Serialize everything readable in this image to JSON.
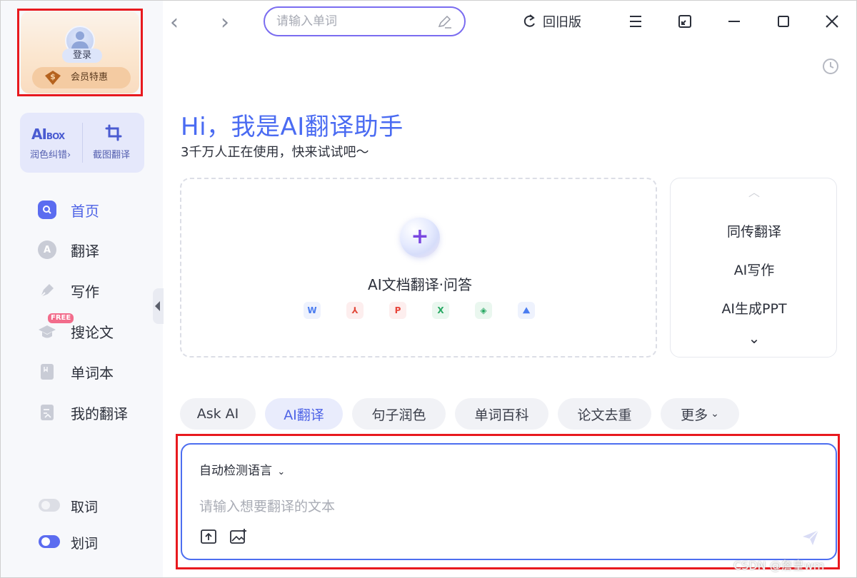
{
  "sidebar": {
    "login_label": "登录",
    "vip_label": "会员特惠",
    "toolbox": {
      "aibox_logo": "AI",
      "aibox_logo_small": "BOX",
      "polish_label": "润色纠错",
      "polish_chevron": "›",
      "screenshot_label": "截图翻译"
    },
    "nav": [
      {
        "label": "首页",
        "icon": "home-icon"
      },
      {
        "label": "翻译",
        "icon": "translate-icon"
      },
      {
        "label": "写作",
        "icon": "pen-icon"
      },
      {
        "label": "搜论文",
        "icon": "graduation-cap-icon",
        "badge": "FREE"
      },
      {
        "label": "单词本",
        "icon": "notebook-icon"
      },
      {
        "label": "我的翻译",
        "icon": "document-icon"
      }
    ],
    "toggles": [
      {
        "label": "取词",
        "on": false
      },
      {
        "label": "划词",
        "on": true
      }
    ]
  },
  "topbar": {
    "back": "‹",
    "forward": "›",
    "search_placeholder": "请输入单词",
    "old_version_label": "回旧版"
  },
  "hero": {
    "title": "Hi，我是AI翻译助手",
    "subtitle": "3千万人正在使用，快来试试吧～"
  },
  "doc_translate": {
    "plus": "+",
    "title": "AI文档翻译·问答",
    "file_types": [
      {
        "letter": "W",
        "icon": "word-file-icon",
        "color": "#4a7cf0",
        "bg": "#eef2fd"
      },
      {
        "letter": "⅄",
        "icon": "pdf-file-icon",
        "color": "#e24a3b",
        "bg": "#fdeeee"
      },
      {
        "letter": "P",
        "icon": "ppt-file-icon",
        "color": "#e8443a",
        "bg": "#fdeeee"
      },
      {
        "letter": "X",
        "icon": "excel-file-icon",
        "color": "#27a862",
        "bg": "#eaf7ef"
      },
      {
        "letter": "◈",
        "icon": "epub-file-icon",
        "color": "#27a862",
        "bg": "#eaf7ef"
      },
      {
        "letter": "⛰",
        "icon": "image-file-icon",
        "color": "#4a7cf0",
        "bg": "#eef2fd"
      }
    ]
  },
  "features": {
    "up": "︿",
    "items": [
      "同传翻译",
      "AI写作",
      "AI生成PPT"
    ],
    "down": "⌄"
  },
  "chips": [
    {
      "label": "Ask AI",
      "active": false
    },
    {
      "label": "AI翻译",
      "active": true
    },
    {
      "label": "句子润色",
      "active": false
    },
    {
      "label": "单词百科",
      "active": false
    },
    {
      "label": "论文去重",
      "active": false
    },
    {
      "label": "更多",
      "active": false,
      "chevron": "⌄"
    }
  ],
  "input": {
    "language": "自动检测语言",
    "language_chevron": "⌄",
    "placeholder": "请输入想要翻译的文本"
  },
  "watermark": "CSDN @詹皇wm",
  "colors": {
    "accent": "#4e63e6",
    "highlight_outline": "#e8191e"
  }
}
